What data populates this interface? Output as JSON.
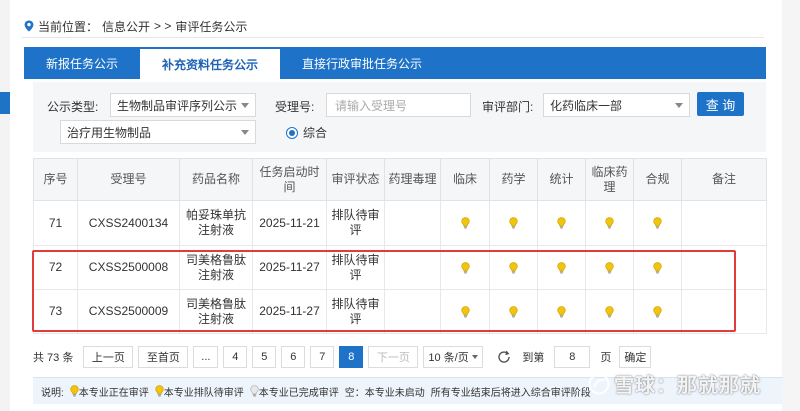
{
  "breadcrumb": {
    "prefix": "当前位置：",
    "home": "信息公开",
    "sep": "> >",
    "current": "审评任务公示"
  },
  "tabs": [
    {
      "label": "新报任务公示",
      "active": false
    },
    {
      "label": "补充资料任务公示",
      "active": true
    },
    {
      "label": "直接行政审批任务公示",
      "active": false
    }
  ],
  "filters": {
    "type_label": "公示类型:",
    "type_value": "生物制品审评序列公示",
    "subtype_value": "治疗用生物制品",
    "accept_label": "受理号:",
    "accept_placeholder": "请输入受理号",
    "dept_label": "审评部门:",
    "dept_value": "化药临床一部",
    "query_button": "查 询",
    "radio_label": "综合"
  },
  "table": {
    "headers": [
      "序号",
      "受理号",
      "药品名称",
      "任务启动时间",
      "审评状态",
      "药理毒理",
      "临床",
      "药学",
      "统计",
      "临床药理",
      "合规",
      "备注"
    ],
    "rows": [
      {
        "no": "71",
        "accept": "CXSS2400134",
        "drug": "帕妥珠单抗注射液",
        "date": "2025-11-21",
        "status": "排队待审评"
      },
      {
        "no": "72",
        "accept": "CXSS2500008",
        "drug": "司美格鲁肽注射液",
        "date": "2025-11-27",
        "status": "排队待审评"
      },
      {
        "no": "73",
        "accept": "CXSS2500009",
        "drug": "司美格鲁肽注射液",
        "date": "2025-11-27",
        "status": "排队待审评"
      }
    ]
  },
  "pager": {
    "total": "共 73 条",
    "prev": "上一页",
    "first": "至首页",
    "ellipsis": "...",
    "pages": [
      "4",
      "5",
      "6",
      "7",
      "8"
    ],
    "current_page": "8",
    "next": "下一页",
    "per_page": "10 条/页",
    "goto_label": "到第",
    "goto_value": "8",
    "page_unit": "页",
    "confirm": "确定"
  },
  "legend": {
    "title": "说明:",
    "items": [
      "本专业正在审评",
      "本专业排队待审评",
      "本专业已完成审评",
      "空：本专业未启动",
      "所有专业结束后将进入综合审评阶段"
    ]
  },
  "watermark": "雪球：那就那就",
  "colors": {
    "primary": "#1e73c9",
    "highlight_box": "#e23b3b",
    "bulb": "#f1c40f"
  }
}
